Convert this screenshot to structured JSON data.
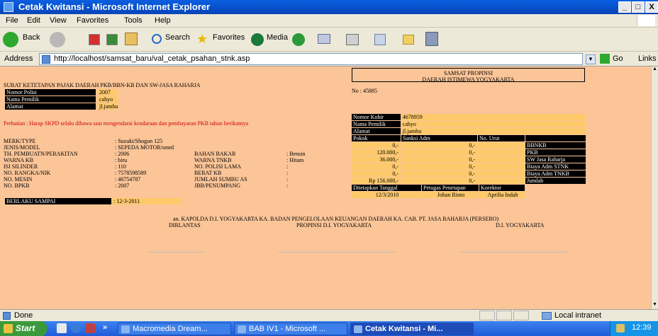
{
  "window": {
    "title": "Cetak Kwitansi - Microsoft Internet Explorer",
    "controls": [
      "_",
      "□",
      "X"
    ]
  },
  "menu": [
    "File",
    "Edit",
    "View",
    "Favorites",
    "Tools",
    "Help"
  ],
  "toolbar": {
    "back": "Back",
    "search": "Search",
    "favorites": "Favorites",
    "media": "Media"
  },
  "address": {
    "label": "Address",
    "url": "http://localhost/samsat_baru/val_cetak_psahan_stnk.asp",
    "go": "Go",
    "links": "Links"
  },
  "page": {
    "title": "SURAT KETETAPAN PAJAK DAERAH PKB/BBN-KB DAN SW-JASA RAHARJA",
    "header_box": {
      "line1": "SAMSAT PROPINSI",
      "line2": "DAERAH ISTIMEWA YOGYAKARTA"
    },
    "no": "No : 45885",
    "owner_rows": [
      {
        "label": "Nomor Polisi",
        "value": "2007"
      },
      {
        "label": "Nama Pemilik",
        "value": "cahyo"
      },
      {
        "label": "Alamat",
        "value": "jl.jambu"
      }
    ],
    "warning": "Perhatian : Harap SKPD selalu dibawa saat mengendarai kendaraan dan pembayaran PKB tahun berikutnya",
    "vehicle_left": [
      {
        "label": "MERK/TYPE",
        "value": ": Suzuki/Shogun 125"
      },
      {
        "label": "JENIS/MODEL",
        "value": ": SEPEDA MOTOR/smrd"
      },
      {
        "label": "TH. PEMBUATN/PERAKITAN",
        "value": ": 2006"
      },
      {
        "label": "WARNA KB",
        "value": ": biru"
      },
      {
        "label": "ISI SILINDER",
        "value": ": 110"
      },
      {
        "label": "NO. RANGKA/NIK",
        "value": ": 7578598589"
      },
      {
        "label": "NO. MESIN",
        "value": ": 46754787"
      },
      {
        "label": "NO. BPKB",
        "value": ": 2007"
      }
    ],
    "vehicle_mid": [
      {
        "label": "BAHAN BAKAR",
        "value": ": Bensin"
      },
      {
        "label": "WARNA TNKB",
        "value": ": Hitam"
      },
      {
        "label": "NO. POLISI LAMA",
        "value": ":"
      },
      {
        "label": "BERAT KB",
        "value": ":"
      },
      {
        "label": "JUMLAH SUMBU AS",
        "value": ":"
      },
      {
        "label": "JBB/PENUMPANG",
        "value": ":"
      }
    ],
    "berlaku": {
      "label": "BERLAKU SAMPAI",
      "value": ": 12-3-2011"
    },
    "kohir_rows": [
      {
        "label": "Nomor Kohir",
        "value": "4678959"
      },
      {
        "label": "Nama Pemilik",
        "value": "cahyo"
      },
      {
        "label": "Alamat",
        "value": "jl.jambu"
      }
    ],
    "fee_headers": [
      "Pokok",
      "Sanksi Adm",
      "No. Urut",
      ""
    ],
    "fee_rows": [
      {
        "pokok": "0,-",
        "sanksi": "0,-",
        "label": "BBNKB"
      },
      {
        "pokok": "120.000,-",
        "sanksi": "0,-",
        "label": "PKB"
      },
      {
        "pokok": "36.000,-",
        "sanksi": "0,-",
        "label": "SW Jasa Raharja"
      },
      {
        "pokok": "0,-",
        "sanksi": "0,-",
        "label": "Biaya Adm STNK"
      },
      {
        "pokok": "0,-",
        "sanksi": "0,-",
        "label": "Biaya Adm TNKB"
      },
      {
        "pokok": "Rp 156.000,-",
        "sanksi": "0,-",
        "label": "Jumlah"
      }
    ],
    "footer_headers": [
      "Ditetapkan Tanggal",
      "Petugas Penetapan",
      "Korektor"
    ],
    "footer_values": [
      "12/3/2010",
      "Johan Rinto",
      "Aprilia Indah"
    ],
    "signatures": {
      "line1": "an. KAPOLDA D.I. YOGYAKARTA  KA. BADAN PENGELOLAAN KEUANGAN DAERAH  KA. CAB. PT. JASA RAHARJA (PERSERO)",
      "s1": "DIRLANTAS",
      "s2": "PROPINSI D.I. YOGYAKARTA",
      "s3": "D.I. YOGYAKARTA"
    }
  },
  "status": {
    "text": "Done",
    "zone": "Local intranet"
  },
  "taskbar": {
    "start": "Start",
    "more": "»",
    "tasks": [
      "Macromedia Dream...",
      "BAB IV1 - Microsoft ...",
      "Cetak Kwitansi - Mi..."
    ],
    "time": "12:39"
  },
  "colors": {
    "page_bg": "#fbc598",
    "cell_bg": "#fdc96b",
    "label_bg": "#000000",
    "warning": "#d00000"
  }
}
